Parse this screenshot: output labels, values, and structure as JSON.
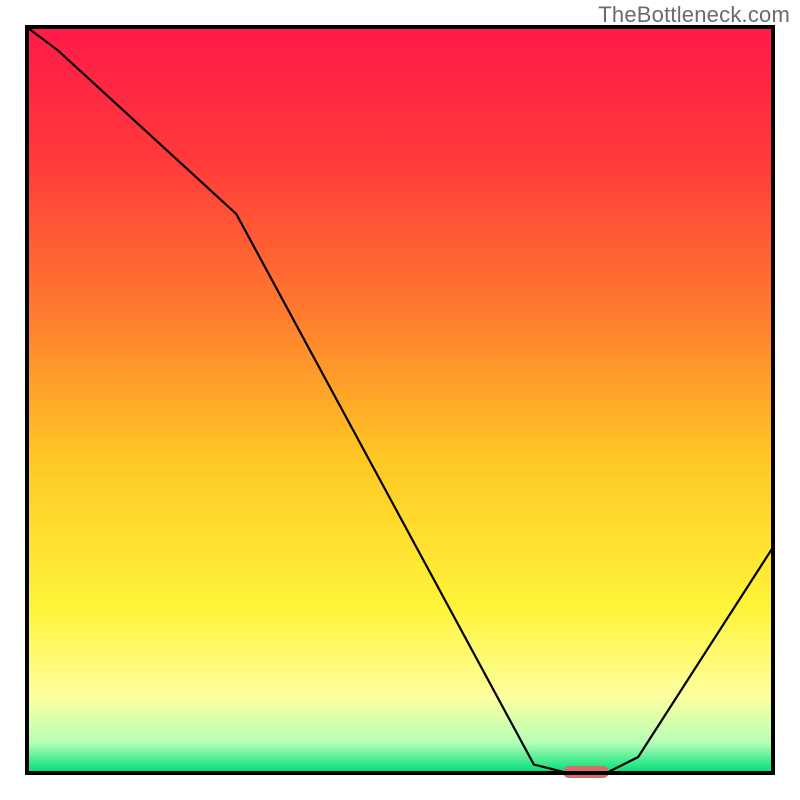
{
  "attribution": "TheBottleneck.com",
  "chart_data": {
    "type": "line",
    "title": "",
    "xlabel": "",
    "ylabel": "",
    "xlim": [
      0,
      100
    ],
    "ylim": [
      0,
      100
    ],
    "x": [
      0,
      4,
      28,
      68,
      72,
      78,
      82,
      100
    ],
    "values": [
      100,
      97,
      75,
      1,
      0,
      0,
      2,
      30
    ],
    "marker": {
      "x": 75,
      "y": 0,
      "color": "#d96b6b"
    },
    "background_gradient_stops": [
      {
        "offset": 0.0,
        "color": "#ff1a4a"
      },
      {
        "offset": 0.18,
        "color": "#ff3a3a"
      },
      {
        "offset": 0.38,
        "color": "#ff7a2f"
      },
      {
        "offset": 0.58,
        "color": "#ffc824"
      },
      {
        "offset": 0.78,
        "color": "#fff43a"
      },
      {
        "offset": 0.9,
        "color": "#fdffa0"
      },
      {
        "offset": 0.96,
        "color": "#b6ffb6"
      },
      {
        "offset": 1.0,
        "color": "#00e07a"
      }
    ],
    "axis_color": "#000000",
    "line_color": "#000000"
  }
}
